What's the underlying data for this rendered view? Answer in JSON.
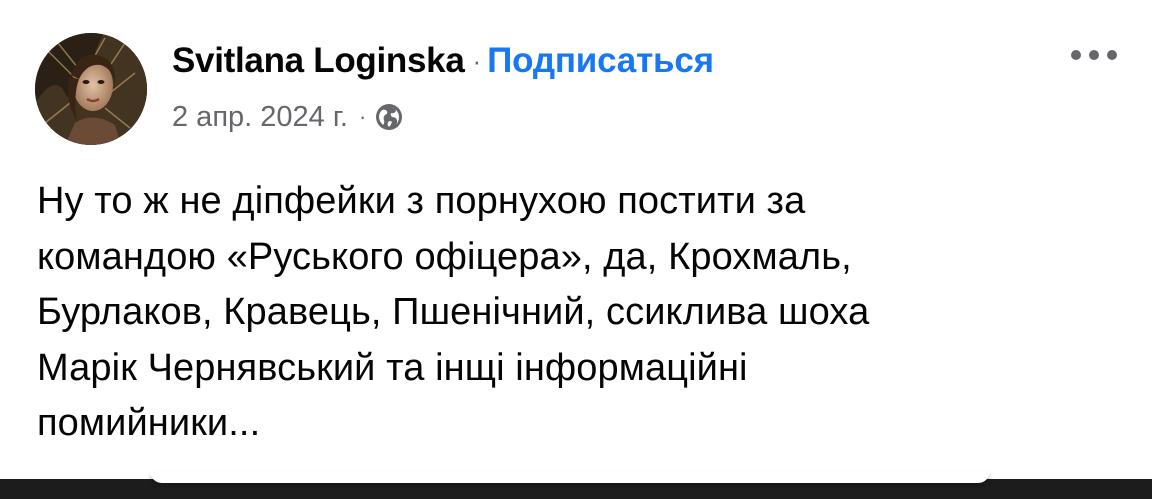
{
  "post": {
    "author": "Svitlana Loginska",
    "separator": "·",
    "follow_label": "Подписаться",
    "date": "2 апр. 2024 г.",
    "meta_separator": "·",
    "audience_icon": "globe-icon",
    "more_icon": "more-horizontal-icon",
    "text_lines": [
      "Ну то ж не діпфейки з порнухою постити за",
      "командою «Руського офіцера», да, Крохмаль,",
      "Бурлаков, Кравець, Пшенічний, ссиклива шоха",
      "Марік Чернявський та інщі інформаційні",
      "помийники..."
    ]
  },
  "colors": {
    "link": "#1877f2",
    "primary_text": "#050505",
    "secondary_text": "#65676b",
    "background": "#ffffff",
    "bottom_bar": "#1c1c1c"
  }
}
